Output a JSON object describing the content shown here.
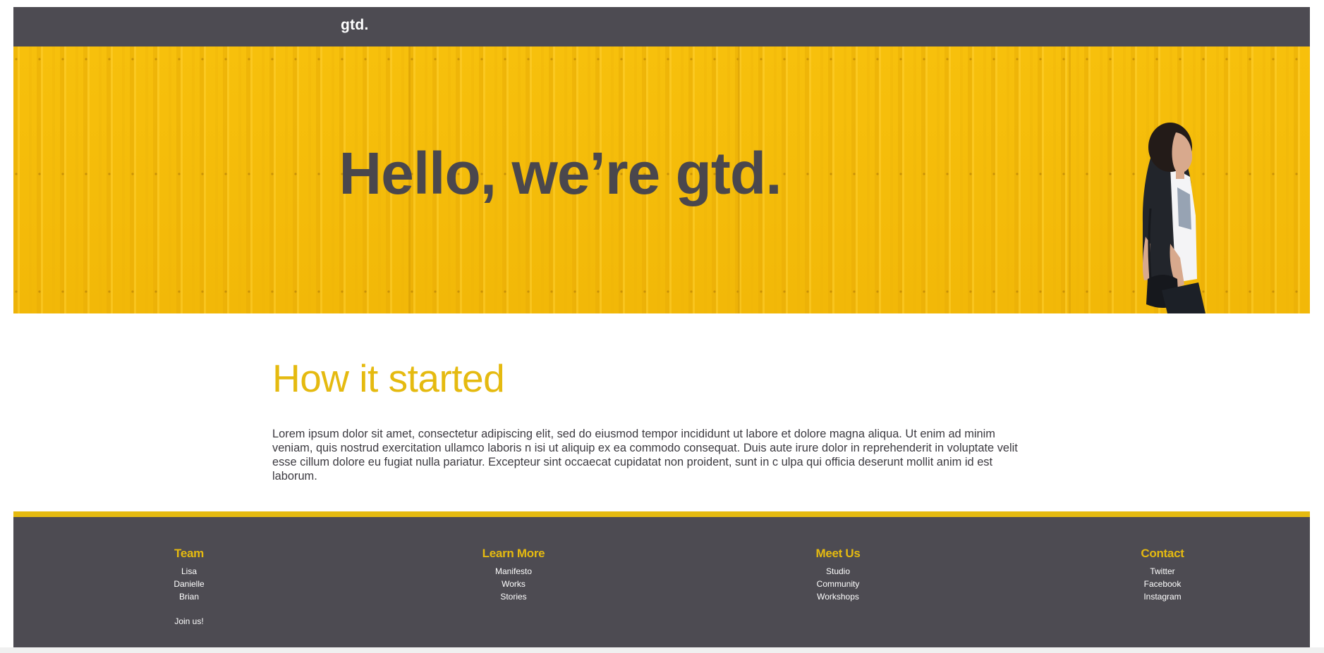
{
  "header": {
    "brand": "gtd."
  },
  "hero": {
    "title": "Hello, we’re gtd."
  },
  "about": {
    "title": "How it started",
    "body": "Lorem ipsum dolor sit amet, consectetur adipiscing elit, sed do eiusmod tempor incididunt ut labore et dolore magna aliqua. Ut enim ad minim veniam, quis nostrud exercitation ullamco laboris n isi ut aliquip ex ea commodo consequat. Duis aute irure dolor in reprehenderit in voluptate velit esse cillum dolore eu fugiat nulla pariatur. Excepteur sint occaecat cupidatat non proident, sunt in c ulpa qui officia deserunt mollit anim id est laborum."
  },
  "footer": {
    "columns": [
      {
        "title": "Team",
        "links": [
          "Lisa",
          "Danielle",
          "Brian"
        ],
        "extra": "Join us!"
      },
      {
        "title": "Learn More",
        "links": [
          "Manifesto",
          "Works",
          "Stories"
        ]
      },
      {
        "title": "Meet Us",
        "links": [
          "Studio",
          "Community",
          "Workshops"
        ]
      },
      {
        "title": "Contact",
        "links": [
          "Twitter",
          "Facebook",
          "Instagram"
        ]
      }
    ]
  },
  "colors": {
    "dark": "#4d4b52",
    "accent": "#e5ba10",
    "hero_yellow": "#f8c20a"
  }
}
